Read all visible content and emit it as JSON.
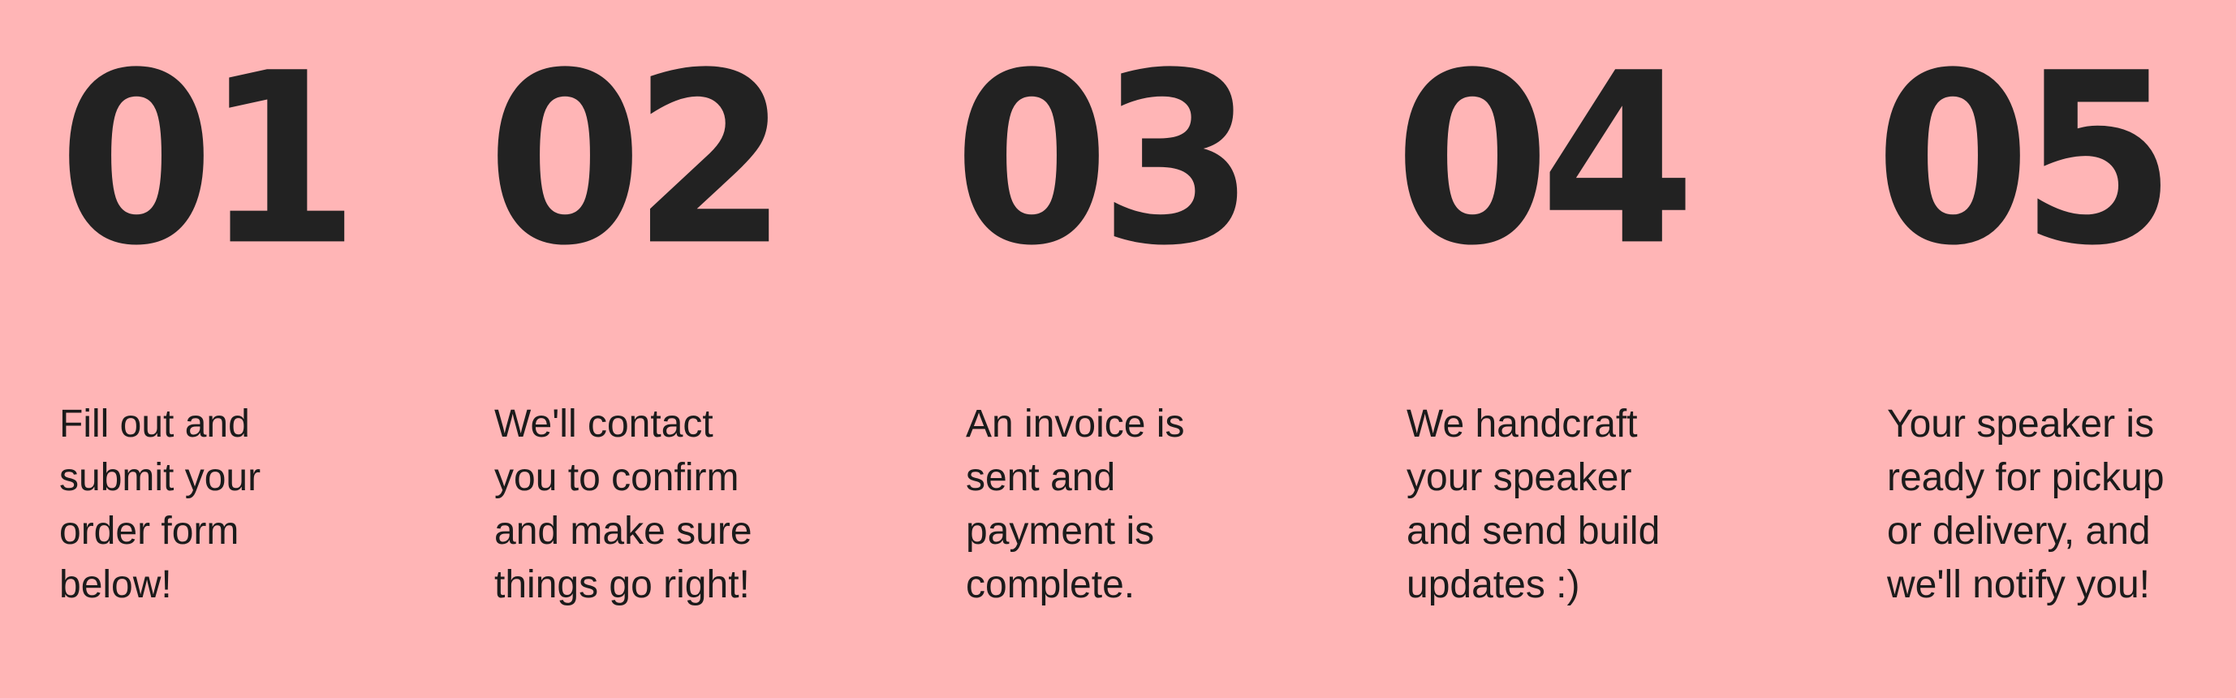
{
  "colors": {
    "background": "#ffb5b6",
    "number": "#222222",
    "text": "#1b1b1b"
  },
  "steps": [
    {
      "number": "01",
      "lines": [
        "Fill out and",
        "submit your",
        "order form",
        "below!"
      ]
    },
    {
      "number": "02",
      "lines": [
        "We'll contact",
        "you to confirm",
        "and make sure",
        "things go right!"
      ]
    },
    {
      "number": "03",
      "lines": [
        "An invoice is",
        "sent and",
        "payment is",
        "complete."
      ]
    },
    {
      "number": "04",
      "lines": [
        "We handcraft",
        "your speaker",
        "and send build",
        "updates :)"
      ]
    },
    {
      "number": "05",
      "lines": [
        "Your speaker is",
        "ready for pickup",
        "or delivery, and",
        "we'll notify you!"
      ]
    }
  ]
}
